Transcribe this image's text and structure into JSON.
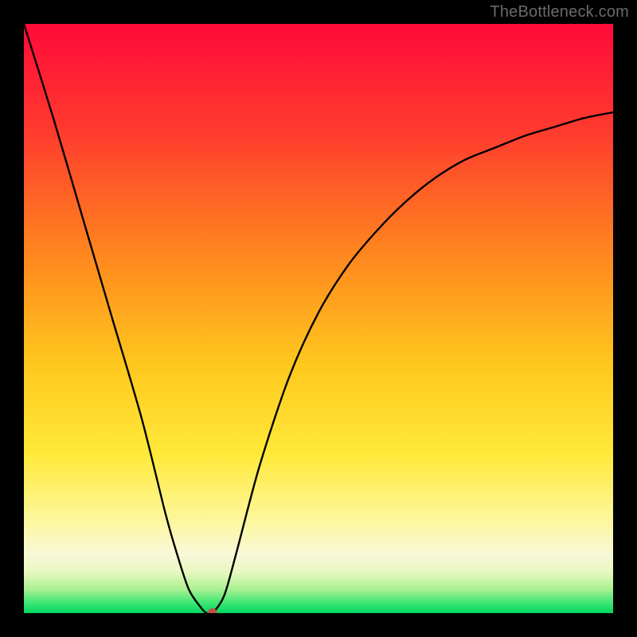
{
  "watermark": "TheBottleneck.com",
  "chart_data": {
    "type": "line",
    "title": "",
    "xlabel": "",
    "ylabel": "",
    "xlim": [
      0,
      100
    ],
    "ylim": [
      0,
      100
    ],
    "x": [
      0,
      5,
      10,
      15,
      20,
      24,
      26,
      28,
      30,
      31,
      32,
      34,
      36,
      40,
      45,
      50,
      55,
      60,
      65,
      70,
      75,
      80,
      85,
      90,
      95,
      100
    ],
    "values": [
      100,
      84,
      67,
      50,
      33,
      17,
      10,
      4,
      1,
      0,
      0,
      3,
      10,
      25,
      40,
      51,
      59,
      65,
      70,
      74,
      77,
      79,
      81,
      82.5,
      84,
      85
    ],
    "marker": {
      "x": 32,
      "y": 0,
      "color": "#c05048",
      "radius": 6
    },
    "gradient_stops": [
      {
        "offset": 0,
        "color": "#ff0a3a"
      },
      {
        "offset": 18,
        "color": "#ff3a2e"
      },
      {
        "offset": 40,
        "color": "#ff8a1e"
      },
      {
        "offset": 58,
        "color": "#ffc81e"
      },
      {
        "offset": 73,
        "color": "#ffe93a"
      },
      {
        "offset": 84,
        "color": "#fdf79a"
      },
      {
        "offset": 90,
        "color": "#f8f8d8"
      },
      {
        "offset": 93,
        "color": "#e8f8c0"
      },
      {
        "offset": 96,
        "color": "#a8f090"
      },
      {
        "offset": 98,
        "color": "#48e878"
      },
      {
        "offset": 100,
        "color": "#00d860"
      }
    ],
    "curve_color": "#000000",
    "curve_width": 2.4
  }
}
